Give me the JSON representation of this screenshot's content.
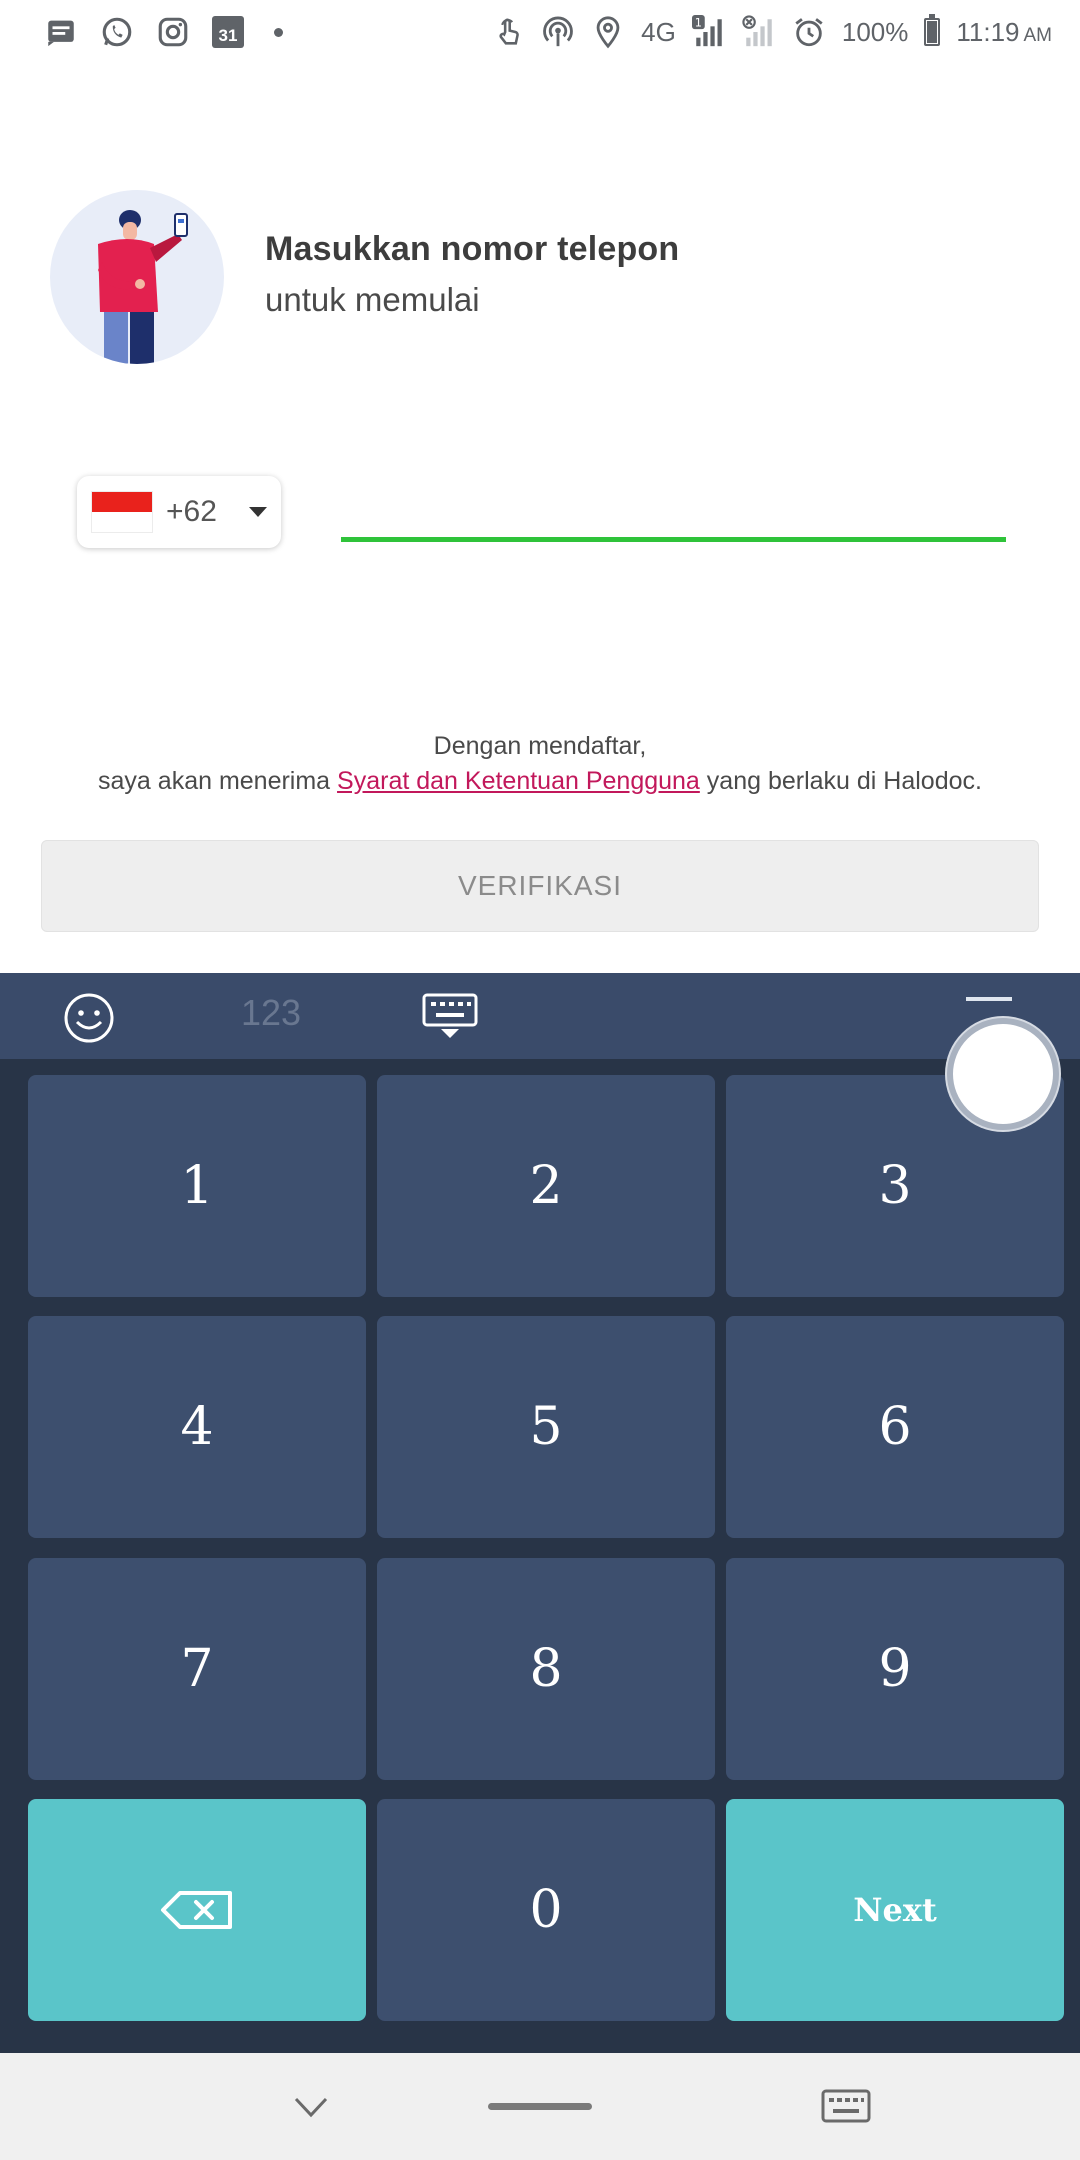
{
  "status_bar": {
    "calendar_day": "31",
    "network": "4G",
    "sim_badge": "1",
    "battery": "100%",
    "time": "11:19",
    "ampm": "AM",
    "left_icons": [
      "message-icon",
      "whatsapp-icon",
      "instagram-icon",
      "calendar-icon",
      "dot-icon"
    ],
    "right_icons": [
      "touch-icon",
      "hotspot-icon",
      "location-icon",
      "signal-icon",
      "no-signal-icon",
      "alarm-icon",
      "battery-icon"
    ]
  },
  "header": {
    "title": "Masukkan nomor telepon",
    "subtitle": "untuk memulai"
  },
  "phone": {
    "country_code": "+62",
    "flag": "indonesia-flag",
    "value": "",
    "underline_color": "#2fc33a"
  },
  "terms": {
    "line1": "Dengan mendaftar,",
    "prefix": "saya akan menerima ",
    "link": "Syarat dan Ketentuan Pengguna",
    "suffix": " yang berlaku di Halodoc.",
    "link_color": "#c2185b"
  },
  "verify_button": {
    "label": "VERIFIKASI"
  },
  "keyboard": {
    "toolbar": {
      "numbers_tab": "123",
      "icons": [
        "emoji-icon",
        "keyboard-hide-icon",
        "menu-icon"
      ]
    },
    "keys": [
      "1",
      "2",
      "3",
      "4",
      "5",
      "6",
      "7",
      "8",
      "9",
      "0"
    ],
    "next_label": "Next",
    "colors": {
      "background": "#283447",
      "key": "#3d4f6e",
      "action": "#5ac5c9"
    }
  },
  "navbar": {
    "icons": [
      "back-icon",
      "home-bar",
      "keyboard-icon"
    ]
  }
}
